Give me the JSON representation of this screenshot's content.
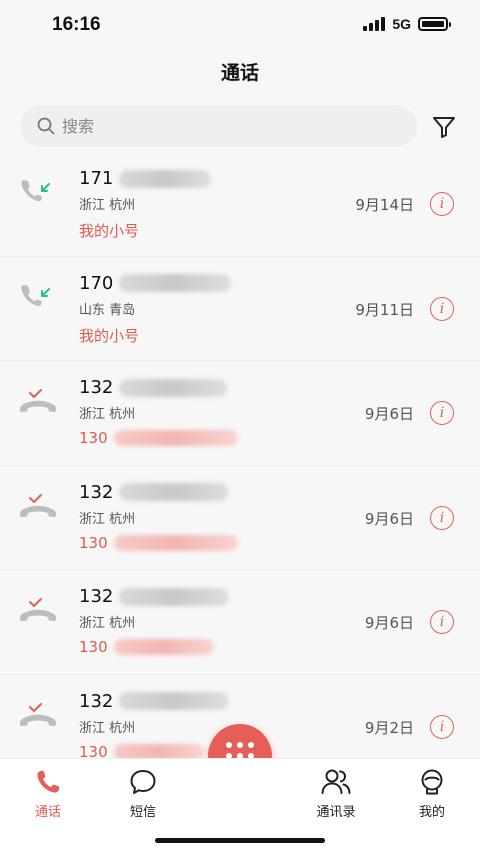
{
  "status_bar": {
    "time": "16:16",
    "network": "5G"
  },
  "page": {
    "title": "通话"
  },
  "search": {
    "placeholder": "搜索"
  },
  "calls": [
    {
      "number_prefix": "171",
      "location": "浙江 杭州",
      "sub_prefix": "我的小号",
      "date": "9月14日",
      "type": "incoming"
    },
    {
      "number_prefix": "170",
      "location": "山东 青岛",
      "sub_prefix": "我的小号",
      "date": "9月11日",
      "type": "incoming"
    },
    {
      "number_prefix": "132",
      "location": "浙江 杭州",
      "sub_prefix": "130",
      "date": "9月6日",
      "type": "missed"
    },
    {
      "number_prefix": "132",
      "location": "浙江 杭州",
      "sub_prefix": "130",
      "date": "9月6日",
      "type": "missed"
    },
    {
      "number_prefix": "132",
      "location": "浙江 杭州",
      "sub_prefix": "130",
      "date": "9月6日",
      "type": "missed"
    },
    {
      "number_prefix": "132",
      "location": "浙江 杭州",
      "sub_prefix": "130",
      "date": "9月2日",
      "type": "missed"
    }
  ],
  "tabs": [
    {
      "label": "通话",
      "icon": "phone-icon",
      "active": true
    },
    {
      "label": "短信",
      "icon": "message-icon",
      "active": false
    },
    {
      "label": "通讯录",
      "icon": "contacts-icon",
      "active": false
    },
    {
      "label": "我的",
      "icon": "profile-icon",
      "active": false
    }
  ],
  "colors": {
    "accent": "#e35f57",
    "incoming_arrow": "#27c27a",
    "missed_mark": "#e35f57"
  }
}
